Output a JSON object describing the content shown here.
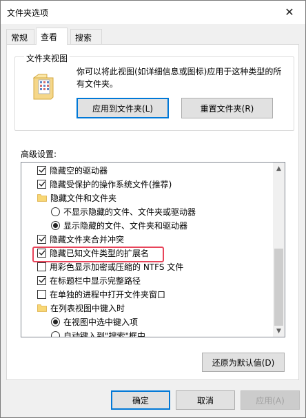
{
  "window": {
    "title": "文件夹选项",
    "close_glyph": "✕"
  },
  "tabs": [
    {
      "label": "常规"
    },
    {
      "label": "查看"
    },
    {
      "label": "搜索"
    }
  ],
  "folder_views": {
    "legend": "文件夹视图",
    "description": "你可以将此视图(如详细信息或图标)应用于这种类型的所有文件夹。",
    "apply_button": "应用到文件夹(L)",
    "reset_button": "重置文件夹(R)"
  },
  "advanced": {
    "label": "高级设置:",
    "items": [
      {
        "type": "checkbox",
        "checked": true,
        "indent": 1,
        "label": "隐藏空的驱动器"
      },
      {
        "type": "checkbox",
        "checked": true,
        "indent": 1,
        "label": "隐藏受保护的操作系统文件(推荐)"
      },
      {
        "type": "folder",
        "indent": 1,
        "label": "隐藏文件和文件夹"
      },
      {
        "type": "radio",
        "checked": false,
        "indent": 2,
        "label": "不显示隐藏的文件、文件夹或驱动器"
      },
      {
        "type": "radio",
        "checked": true,
        "indent": 2,
        "label": "显示隐藏的文件、文件夹和驱动器"
      },
      {
        "type": "checkbox",
        "checked": true,
        "indent": 1,
        "label": "隐藏文件夹合并冲突"
      },
      {
        "type": "checkbox",
        "checked": true,
        "indent": 1,
        "label": "隐藏已知文件类型的扩展名"
      },
      {
        "type": "checkbox",
        "checked": false,
        "indent": 1,
        "label": "用彩色显示加密或压缩的 NTFS 文件"
      },
      {
        "type": "checkbox",
        "checked": true,
        "indent": 1,
        "label": "在标题栏中显示完整路径"
      },
      {
        "type": "checkbox",
        "checked": false,
        "indent": 1,
        "label": "在单独的进程中打开文件夹窗口"
      },
      {
        "type": "folder",
        "indent": 1,
        "label": "在列表视图中键入时"
      },
      {
        "type": "radio",
        "checked": true,
        "indent": 2,
        "label": "在视图中选中键入项"
      },
      {
        "type": "radio",
        "checked": false,
        "indent": 2,
        "label": "自动键入到\"搜索\"框中"
      }
    ],
    "restore_defaults": "还原为默认值(D)"
  },
  "footer": {
    "ok": "确定",
    "cancel": "取消",
    "apply": "应用(A)"
  },
  "colors": {
    "highlight": "#e8445a",
    "focus": "#0078d7"
  }
}
